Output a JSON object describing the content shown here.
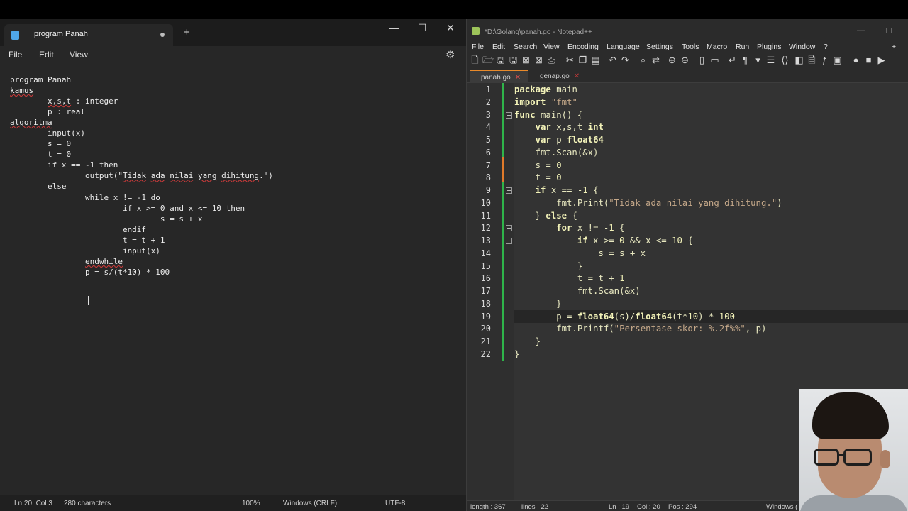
{
  "notepad": {
    "tab_title": "program Panah",
    "menu": [
      "File",
      "Edit",
      "View"
    ],
    "code_lines": [
      [
        {
          "t": "program Panah"
        }
      ],
      [
        {
          "t": "kamus",
          "sq": true
        }
      ],
      [
        {
          "t": "        "
        },
        {
          "t": "x,s,t",
          "sq": true
        },
        {
          "t": " : integer"
        }
      ],
      [
        {
          "t": "        p : real"
        }
      ],
      [
        {
          "t": "algoritma",
          "sq": true
        }
      ],
      [
        {
          "t": "        input(x)"
        }
      ],
      [
        {
          "t": "        s = 0"
        }
      ],
      [
        {
          "t": "        t = 0"
        }
      ],
      [
        {
          "t": "        if x == -1 then"
        }
      ],
      [
        {
          "t": "                output(\""
        },
        {
          "t": "Tidak",
          "sq": true
        },
        {
          "t": " "
        },
        {
          "t": "ada",
          "sq": true
        },
        {
          "t": " "
        },
        {
          "t": "nilai",
          "sq": true
        },
        {
          "t": " "
        },
        {
          "t": "yang",
          "sq": true
        },
        {
          "t": " "
        },
        {
          "t": "dihitung",
          "sq": true
        },
        {
          "t": ".\")"
        }
      ],
      [
        {
          "t": "        else"
        }
      ],
      [
        {
          "t": "                while x != -1 do"
        }
      ],
      [
        {
          "t": "                        if x >= 0 and x <= 10 then"
        }
      ],
      [
        {
          "t": "                                s = s + x"
        }
      ],
      [
        {
          "t": "                        endif"
        }
      ],
      [
        {
          "t": "                        t = t + 1"
        }
      ],
      [
        {
          "t": "                        input(x)"
        }
      ],
      [
        {
          "t": "                "
        },
        {
          "t": "endwhile",
          "sq": true
        }
      ],
      [
        {
          "t": "                p = s/(t*10) * 100"
        }
      ]
    ],
    "status": {
      "position": "Ln 20, Col 3",
      "characters": "280 characters",
      "zoom": "100%",
      "line_ending": "Windows (CRLF)",
      "encoding": "UTF-8"
    }
  },
  "notepadpp": {
    "title": "*D:\\Golang\\panah.go - Notepad++",
    "menu": [
      "File",
      "Edit",
      "Search",
      "View",
      "Encoding",
      "Language",
      "Settings",
      "Tools",
      "Macro",
      "Run",
      "Plugins",
      "Window",
      "?"
    ],
    "tabs": [
      {
        "label": "panah.go",
        "active": true
      },
      {
        "label": "genap.go",
        "active": false
      }
    ],
    "line_numbers": [
      "1",
      "2",
      "3",
      "4",
      "5",
      "6",
      "7",
      "8",
      "9",
      "10",
      "11",
      "12",
      "13",
      "14",
      "15",
      "16",
      "17",
      "18",
      "19",
      "20",
      "21",
      "22"
    ],
    "code_lines": [
      [
        {
          "c": "kw",
          "t": "package"
        },
        {
          "c": "id",
          "t": " main"
        }
      ],
      [
        {
          "c": "kw",
          "t": "import"
        },
        {
          "c": "id",
          "t": " "
        },
        {
          "c": "st",
          "t": "\"fmt\""
        }
      ],
      [
        {
          "c": "kw",
          "t": "func"
        },
        {
          "c": "id",
          "t": " main() {"
        }
      ],
      [
        {
          "c": "id",
          "t": "    "
        },
        {
          "c": "kw",
          "t": "var"
        },
        {
          "c": "id",
          "t": " x,s,t "
        },
        {
          "c": "tp",
          "t": "int"
        }
      ],
      [
        {
          "c": "id",
          "t": "    "
        },
        {
          "c": "kw",
          "t": "var"
        },
        {
          "c": "id",
          "t": " p "
        },
        {
          "c": "tp",
          "t": "float64"
        }
      ],
      [
        {
          "c": "id",
          "t": "    fmt.Scan(&x)"
        }
      ],
      [
        {
          "c": "id",
          "t": "    s = "
        },
        {
          "c": "nm",
          "t": "0"
        }
      ],
      [
        {
          "c": "id",
          "t": "    t = "
        },
        {
          "c": "nm",
          "t": "0"
        }
      ],
      [
        {
          "c": "id",
          "t": "    "
        },
        {
          "c": "kw",
          "t": "if"
        },
        {
          "c": "id",
          "t": " x == -"
        },
        {
          "c": "nm",
          "t": "1"
        },
        {
          "c": "id",
          "t": " {"
        }
      ],
      [
        {
          "c": "id",
          "t": "        fmt.Print("
        },
        {
          "c": "st",
          "t": "\"Tidak ada nilai yang dihitung.\""
        },
        {
          "c": "id",
          "t": ")"
        }
      ],
      [
        {
          "c": "id",
          "t": "    } "
        },
        {
          "c": "kw",
          "t": "else"
        },
        {
          "c": "id",
          "t": " {"
        }
      ],
      [
        {
          "c": "id",
          "t": "        "
        },
        {
          "c": "kw",
          "t": "for"
        },
        {
          "c": "id",
          "t": " x != -"
        },
        {
          "c": "nm",
          "t": "1"
        },
        {
          "c": "id",
          "t": " {"
        }
      ],
      [
        {
          "c": "id",
          "t": "            "
        },
        {
          "c": "kw",
          "t": "if"
        },
        {
          "c": "id",
          "t": " x >= "
        },
        {
          "c": "nm",
          "t": "0"
        },
        {
          "c": "id",
          "t": " && x <= "
        },
        {
          "c": "nm",
          "t": "10"
        },
        {
          "c": "id",
          "t": " {"
        }
      ],
      [
        {
          "c": "id",
          "t": "                s = s + x"
        }
      ],
      [
        {
          "c": "id",
          "t": "            }"
        }
      ],
      [
        {
          "c": "id",
          "t": "            t = t + "
        },
        {
          "c": "nm",
          "t": "1"
        }
      ],
      [
        {
          "c": "id",
          "t": "            fmt.Scan(&x)"
        }
      ],
      [
        {
          "c": "id",
          "t": "        }"
        }
      ],
      [
        {
          "c": "id",
          "t": "        p = "
        },
        {
          "c": "tp",
          "t": "float64"
        },
        {
          "c": "id",
          "t": "(s)/"
        },
        {
          "c": "tp",
          "t": "float64"
        },
        {
          "c": "id",
          "t": "(t*"
        },
        {
          "c": "nm",
          "t": "10"
        },
        {
          "c": "id",
          "t": ") * "
        },
        {
          "c": "nm",
          "t": "100"
        }
      ],
      [
        {
          "c": "id",
          "t": "        fmt.Printf("
        },
        {
          "c": "st",
          "t": "\"Persentase skor: %.2f%%\""
        },
        {
          "c": "id",
          "t": ", p)"
        }
      ],
      [
        {
          "c": "id",
          "t": "    }"
        }
      ],
      [
        {
          "c": "id",
          "t": "}"
        }
      ]
    ],
    "status": {
      "length": "length : 367",
      "lines": "lines : 22",
      "ln": "Ln : 19",
      "col": "Col : 20",
      "pos": "Pos : 294",
      "eol": "Windows ("
    }
  }
}
